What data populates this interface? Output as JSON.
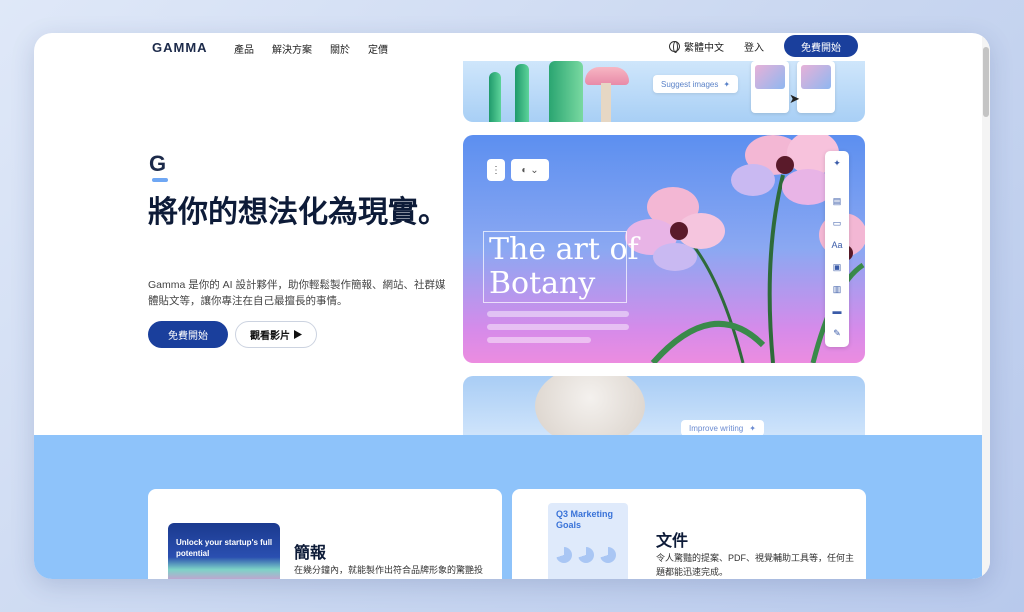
{
  "nav": {
    "logo": "GAMMA",
    "links": [
      "產品",
      "解決方案",
      "關於",
      "定價"
    ],
    "language": "繁體中文",
    "login": "登入",
    "cta": "免費開始"
  },
  "hero": {
    "logo_mark": "G",
    "title": "將你的想法化為現實。",
    "description": "Gamma 是你的 AI 設計夥伴，助你輕鬆製作簡報、網站、社群媒體貼文等，讓你專注在自己最擅長的事情。",
    "primary_cta": "免費開始",
    "secondary_cta": "觀看影片",
    "secondary_icon": "play-icon"
  },
  "showcase": {
    "suggest_label": "Suggest images",
    "art_title": "The art of Botany",
    "improve_label": "Improve writing",
    "colors": {
      "accent": "#1a3f9c",
      "section_bg": "#8ec3fa"
    }
  },
  "features": [
    {
      "thumb_text": "Unlock your startup's full potential",
      "title": "簡報",
      "description": "在幾分鐘內，就能製作出符合品牌形象的驚艷投"
    },
    {
      "thumb_text": "Q3 Marketing Goals",
      "title": "文件",
      "description": "令人驚豔的提案、PDF、視覺輔助工具等，任何主題都能迅速完成。"
    }
  ]
}
